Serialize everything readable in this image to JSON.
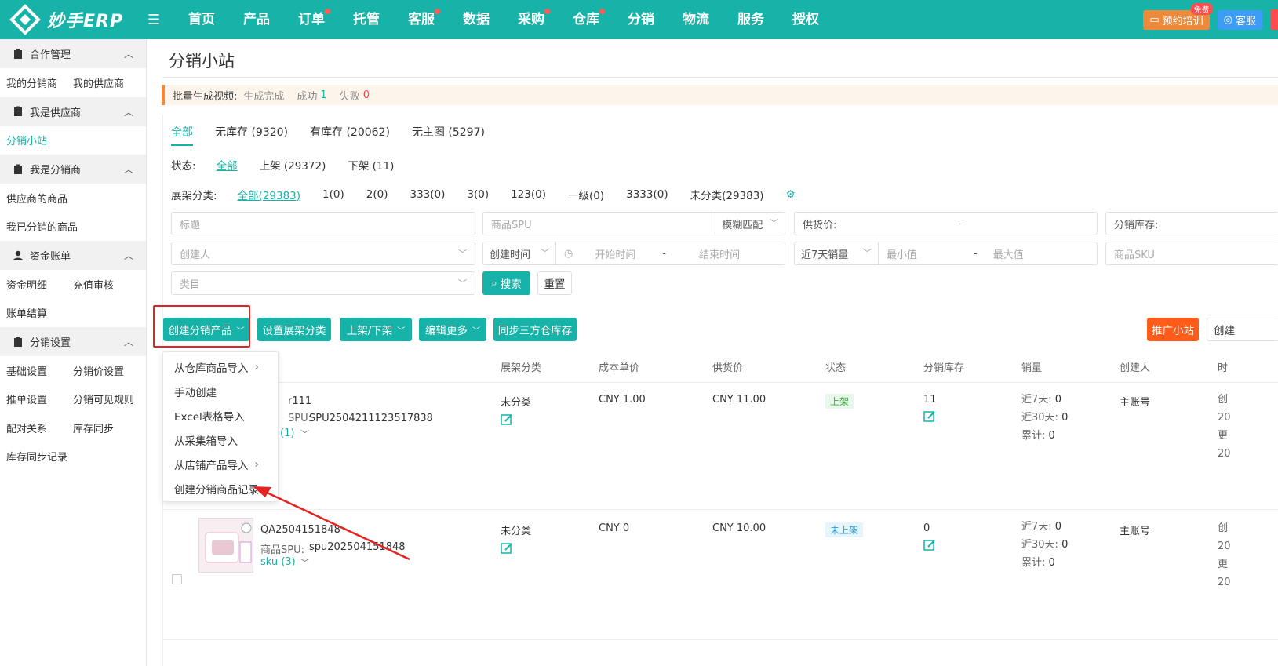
{
  "app": {
    "logo_text": "妙手ERP"
  },
  "nav": [
    {
      "label": "首页",
      "dot": false
    },
    {
      "label": "产品",
      "dot": false
    },
    {
      "label": "订单",
      "dot": true
    },
    {
      "label": "托管",
      "dot": false
    },
    {
      "label": "客服",
      "dot": true
    },
    {
      "label": "数据",
      "dot": false
    },
    {
      "label": "采购",
      "dot": true
    },
    {
      "label": "仓库",
      "dot": true
    },
    {
      "label": "分销",
      "dot": false
    },
    {
      "label": "物流",
      "dot": false
    },
    {
      "label": "服务",
      "dot": false
    },
    {
      "label": "授权",
      "dot": false
    }
  ],
  "topright": {
    "training": "预约培训",
    "free": "免费",
    "service": "客服"
  },
  "sidebar": {
    "g1": "合作管理",
    "g1_items": [
      "我的分销商",
      "我的供应商"
    ],
    "g2": "我是供应商",
    "g2_items": [
      "分销小站"
    ],
    "g3": "我是分销商",
    "g3_items": [
      "供应商的商品",
      "我已分销的商品"
    ],
    "g4": "资金账单",
    "g4_items": [
      "资金明细",
      "充值审核",
      "账单结算"
    ],
    "g5": "分销设置",
    "g5_items": [
      "基础设置",
      "分销价设置",
      "推单设置",
      "分销可见规则",
      "配对关系",
      "库存同步",
      "库存同步记录"
    ]
  },
  "page": {
    "title": "分销小站"
  },
  "notice": {
    "label": "批量生成视频:",
    "status": "生成完成",
    "success_label": "成功",
    "success_count": "1",
    "fail_label": "失败",
    "fail_count": "0"
  },
  "tabs": [
    "全部",
    "无库存 (9320)",
    "有库存 (20062)",
    "无主图 (5297)"
  ],
  "status_filter": {
    "label": "状态:",
    "options": [
      "全部",
      "上架 (29372)",
      "下架 (11)"
    ]
  },
  "shelf_filter": {
    "label": "展架分类:",
    "options": [
      "全部(29383)",
      "1(0)",
      "2(0)",
      "333(0)",
      "3(0)",
      "123(0)",
      "一级(0)",
      "3333(0)",
      "未分类(29383)"
    ]
  },
  "search": {
    "title_ph": "标题",
    "spu_ph": "商品SPU",
    "match": "模糊匹配",
    "supply_price": "供货价:",
    "dash": "-",
    "dist_stock": "分销库存:",
    "creator_ph": "创建人",
    "created_time": "创建时间",
    "start_ph": "开始时间",
    "end_ph": "结束时间",
    "sales_range": "近7天销量",
    "min_ph": "最小值",
    "max_ph": "最大值",
    "sku_ph": "商品SKU",
    "category_ph": "类目",
    "search_btn": "搜索",
    "reset_btn": "重置"
  },
  "actions": {
    "create": "创建分销产品",
    "set_shelf": "设置展架分类",
    "onoff": "上架/下架",
    "edit_more": "编辑更多",
    "sync": "同步三方仓库存",
    "promote": "推广小站",
    "create_right": "创建"
  },
  "dropdown": [
    "从仓库商品导入",
    "手动创建",
    "Excel表格导入",
    "从采集箱导入",
    "从店铺产品导入",
    "创建分销商品记录"
  ],
  "table": {
    "headers": [
      "展架分类",
      "成本单价",
      "供货价",
      "状态",
      "分销库存",
      "销量",
      "创建人",
      "时"
    ],
    "rows": [
      {
        "name": "r111",
        "spu_label": "SPU:",
        "spu": "SPU2504211123517838",
        "sku": "(1)",
        "shelf": "未分类",
        "cost": "CNY 1.00",
        "supply": "CNY 11.00",
        "status": "上架",
        "stock": "11",
        "s7": "近7天:",
        "v7": "0",
        "s30": "近30天:",
        "v30": "0",
        "sall": "累计:",
        "vall": "0",
        "creator": "主账号",
        "t1": "创",
        "t2": "20",
        "t3": "更",
        "t4": "20"
      },
      {
        "name": "QA2504151848",
        "spu_label": "商品SPU:",
        "spu": "spu202504151848",
        "sku": "sku (3)",
        "shelf": "未分类",
        "cost": "CNY 0",
        "supply": "CNY 10.00",
        "status": "未上架",
        "stock": "0",
        "s7": "近7天:",
        "v7": "0",
        "s30": "近30天:",
        "v30": "0",
        "sall": "累计:",
        "vall": "0",
        "creator": "主账号",
        "t1": "创",
        "t2": "20",
        "t3": "更",
        "t4": "20"
      }
    ]
  },
  "colors": {
    "brand": "#17b3a8",
    "accent_orange": "#ff5c1a",
    "alert_red": "#e52222"
  }
}
